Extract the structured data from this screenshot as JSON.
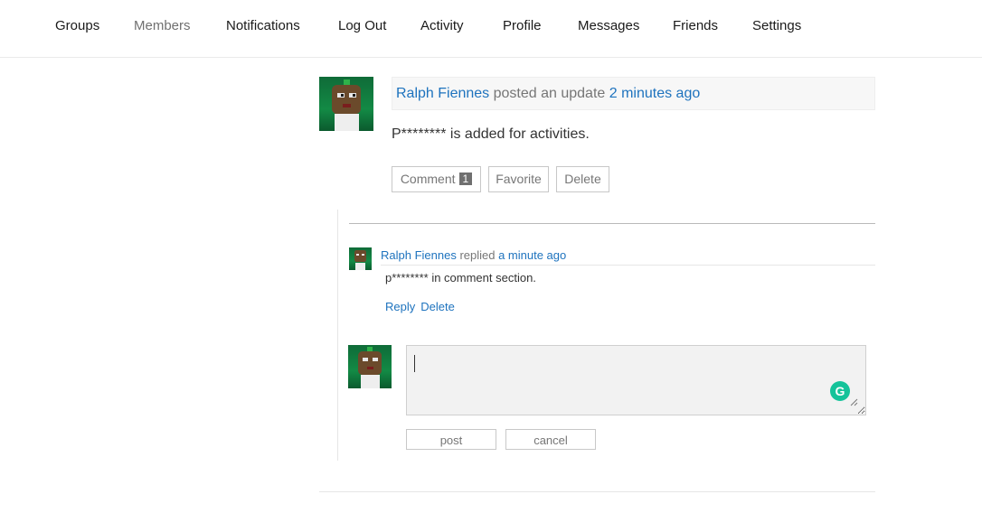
{
  "nav": {
    "items": [
      {
        "label": "Groups"
      },
      {
        "label": "Members"
      },
      {
        "label": "Notifications"
      },
      {
        "label": "Log Out"
      },
      {
        "label": "Activity"
      },
      {
        "label": "Profile"
      },
      {
        "label": "Messages"
      },
      {
        "label": "Friends"
      },
      {
        "label": "Settings"
      }
    ]
  },
  "activity": {
    "author": "Ralph Fiennes",
    "action": " posted an update ",
    "time": "2 minutes ago",
    "content": "P******** is added for activities.",
    "buttons": {
      "comment": "Comment",
      "comment_count": "1",
      "favorite": "Favorite",
      "delete": "Delete"
    }
  },
  "reply": {
    "author": "Ralph Fiennes",
    "action": " replied ",
    "time": "a minute ago",
    "content": "p******** in comment section.",
    "actions": {
      "reply": "Reply",
      "delete": "Delete"
    }
  },
  "comment_form": {
    "value": "",
    "grammarly_glyph": "G",
    "post_label": "post",
    "cancel_label": "cancel"
  },
  "colors": {
    "link": "#1e73be",
    "muted": "#767676",
    "grammarly": "#15c39a"
  }
}
